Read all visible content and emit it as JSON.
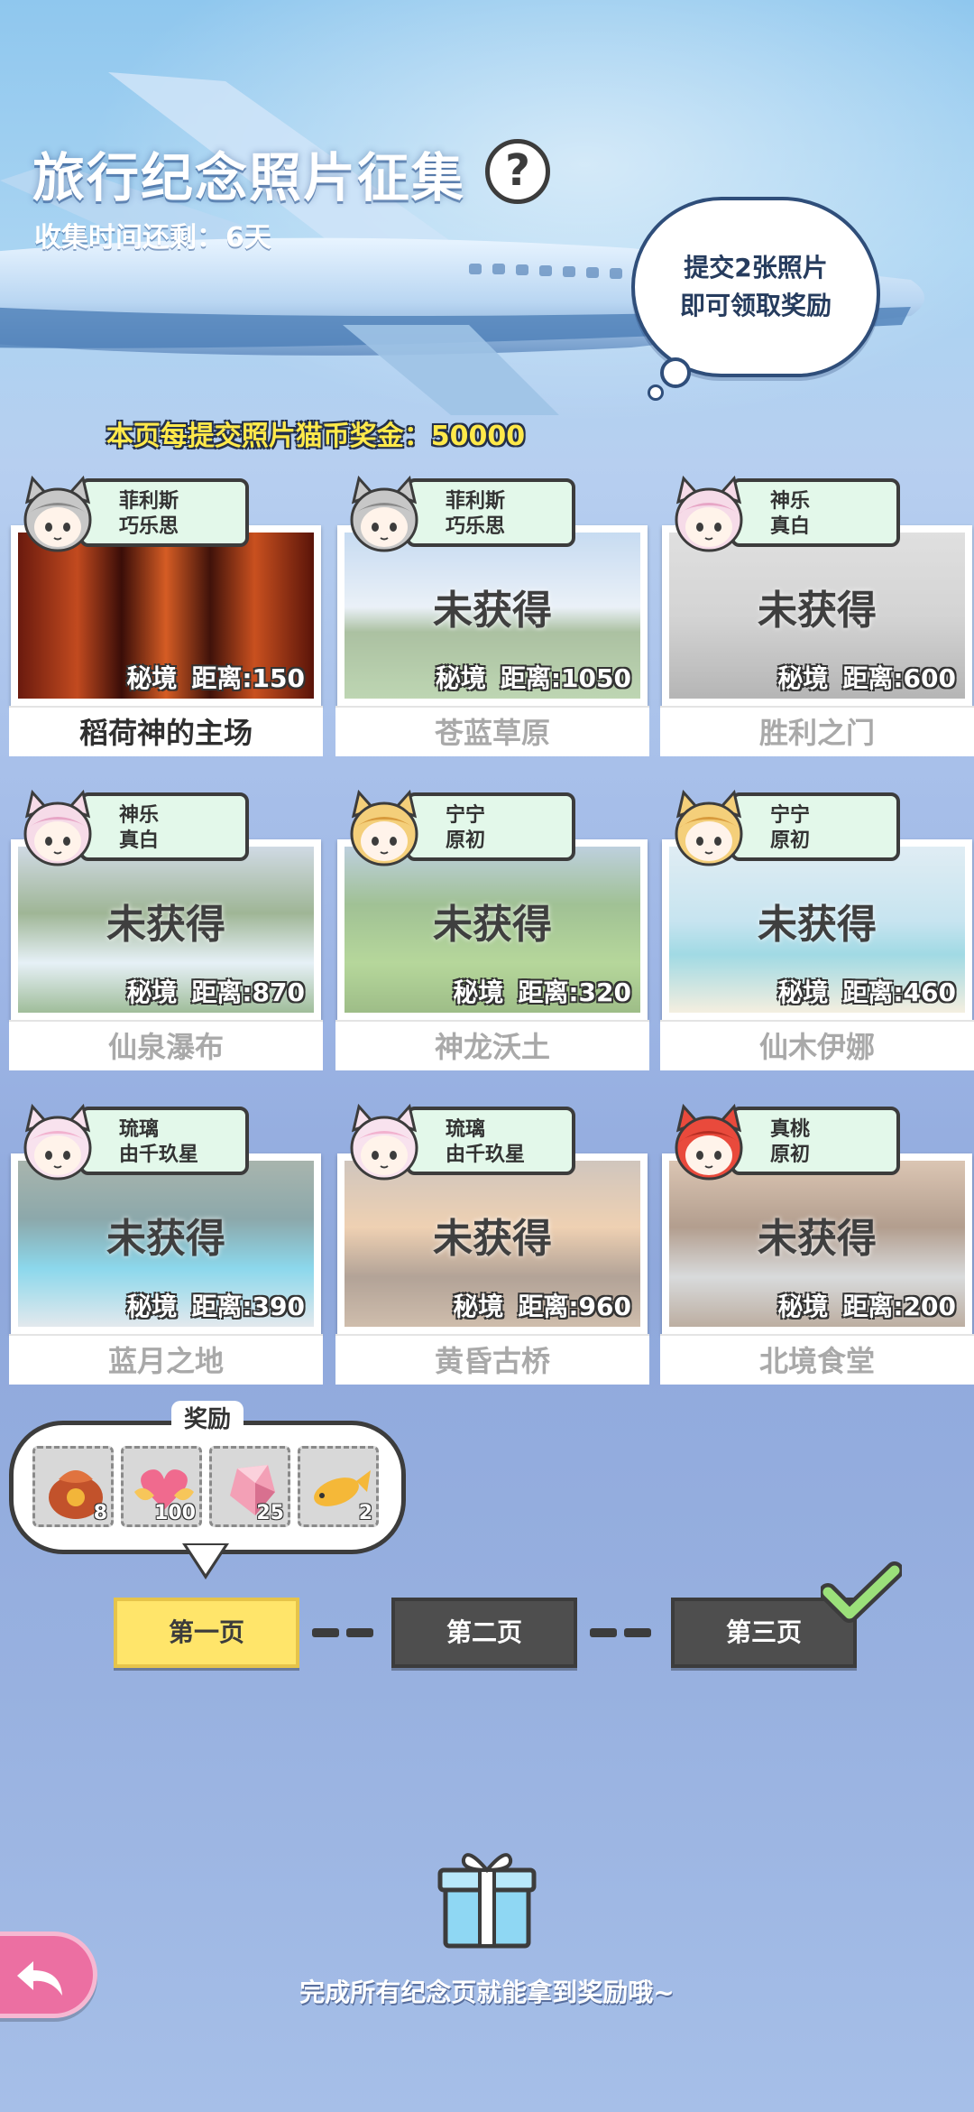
{
  "header": {
    "title": "旅行纪念照片征集",
    "help_label": "?",
    "countdown_label": "收集时间还剩：",
    "countdown_value": "6天",
    "bubble_line1": "提交2张照片",
    "bubble_line2": "即可领取奖励",
    "bonus_text": "本页每提交照片猫币奖金：50000"
  },
  "cards": [
    {
      "char1": "菲利斯",
      "char2": "巧乐思",
      "status": "",
      "area": "秘境",
      "distance": "距离:150",
      "name": "稻荷神的主场"
    },
    {
      "char1": "菲利斯",
      "char2": "巧乐思",
      "status": "未获得",
      "area": "秘境",
      "distance": "距离:1050",
      "name": "苍蓝草原"
    },
    {
      "char1": "神乐",
      "char2": "真白",
      "status": "未获得",
      "area": "秘境",
      "distance": "距离:600",
      "name": "胜利之门"
    },
    {
      "char1": "神乐",
      "char2": "真白",
      "status": "未获得",
      "area": "秘境",
      "distance": "距离:870",
      "name": "仙泉瀑布"
    },
    {
      "char1": "宁宁",
      "char2": "原初",
      "status": "未获得",
      "area": "秘境",
      "distance": "距离:320",
      "name": "神龙沃土"
    },
    {
      "char1": "宁宁",
      "char2": "原初",
      "status": "未获得",
      "area": "秘境",
      "distance": "距离:460",
      "name": "仙木伊娜"
    },
    {
      "char1": "琉璃",
      "char2": "由千玖星",
      "status": "未获得",
      "area": "秘境",
      "distance": "距离:390",
      "name": "蓝月之地"
    },
    {
      "char1": "琉璃",
      "char2": "由千玖星",
      "status": "未获得",
      "area": "秘境",
      "distance": "距离:960",
      "name": "黄昏古桥"
    },
    {
      "char1": "真桃",
      "char2": "原初",
      "status": "未获得",
      "area": "秘境",
      "distance": "距离:200",
      "name": "北境食堂"
    }
  ],
  "reward": {
    "title": "奖励",
    "items": [
      {
        "icon": "lucky-bag-icon",
        "qty": "8"
      },
      {
        "icon": "heart-wings-icon",
        "qty": "100"
      },
      {
        "icon": "crystal-icon",
        "qty": "25"
      },
      {
        "icon": "fish-icon",
        "qty": "2"
      }
    ]
  },
  "tabs": [
    {
      "label": "第一页"
    },
    {
      "label": "第二页"
    },
    {
      "label": "第三页"
    }
  ],
  "footer": {
    "complete_text": "完成所有纪念页就能拿到奖励哦~"
  },
  "colors": {
    "accent_yellow": "#ffe56a",
    "bonus_yellow": "#ffe94a",
    "tag_green": "#e3f8ea",
    "back_pink": "#ec6fa2",
    "check_green": "#9be07a"
  }
}
